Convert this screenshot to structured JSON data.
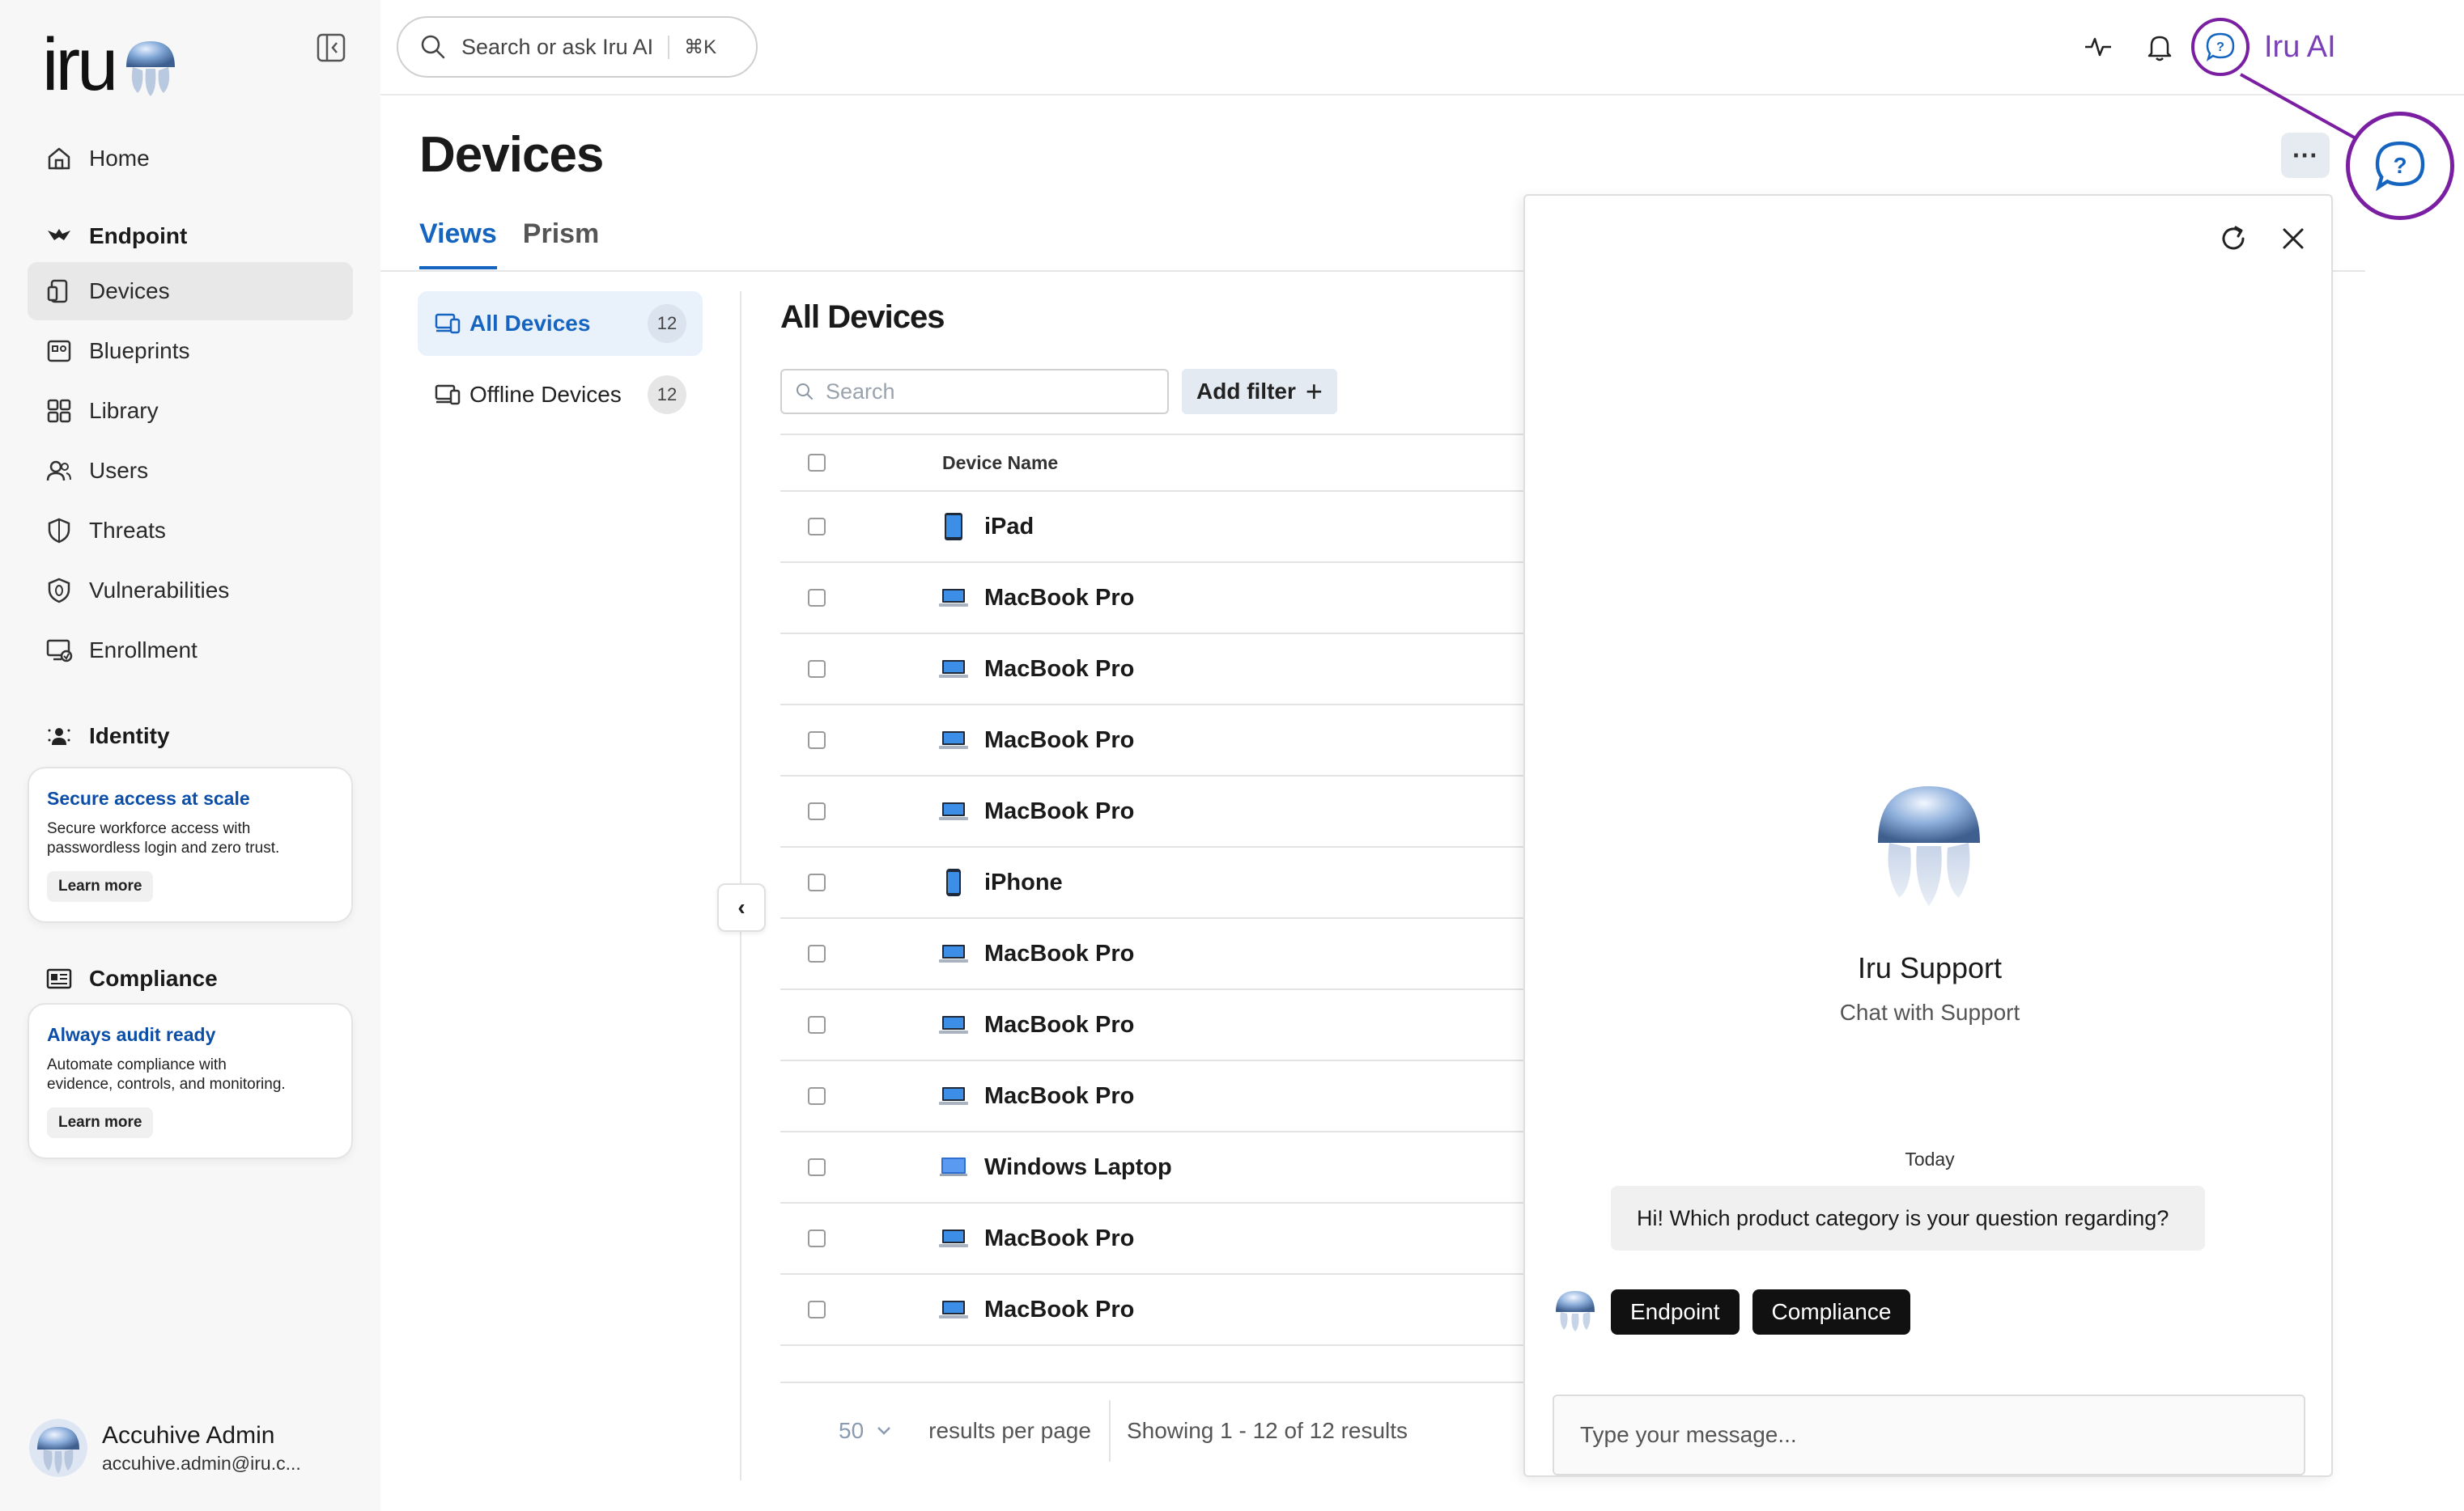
{
  "app": {
    "logo_text": "iru"
  },
  "sidebar": {
    "items": [
      {
        "label": "Home",
        "icon": "home-icon"
      },
      {
        "label": "Devices",
        "icon": "device-icon",
        "active": true
      },
      {
        "label": "Blueprints",
        "icon": "blueprint-icon"
      },
      {
        "label": "Library",
        "icon": "library-grid-icon"
      },
      {
        "label": "Users",
        "icon": "users-icon"
      },
      {
        "label": "Threats",
        "icon": "shield-icon"
      },
      {
        "label": "Vulnerabilities",
        "icon": "shield-bug-icon"
      },
      {
        "label": "Enrollment",
        "icon": "enrollment-icon"
      }
    ],
    "sections": {
      "endpoint": "Endpoint",
      "identity": "Identity",
      "compliance": "Compliance"
    },
    "promos": {
      "identity": {
        "title": "Secure access at scale",
        "body_line1": "Secure workforce access with",
        "body_line2": "passwordless login and zero trust.",
        "button": "Learn more"
      },
      "compliance": {
        "title": "Always audit ready",
        "body_line1": "Automate compliance with",
        "body_line2": "evidence, controls, and monitoring.",
        "button": "Learn more"
      }
    },
    "user": {
      "name": "Accuhive Admin",
      "email": "accuhive.admin@iru.c..."
    }
  },
  "topbar": {
    "search_placeholder": "Search or ask Iru AI",
    "search_shortcut": "⌘K",
    "iru_ai_label": "Iru AI",
    "accent_color": "#7b1fa2"
  },
  "page": {
    "title": "Devices",
    "more_label": "···",
    "tabs": [
      {
        "label": "Views",
        "active": true
      },
      {
        "label": "Prism",
        "active": false
      }
    ],
    "views": [
      {
        "label": "All Devices",
        "count": "12",
        "active": true
      },
      {
        "label": "Offline Devices",
        "count": "12",
        "active": false
      }
    ],
    "collapse_glyph": "‹"
  },
  "table": {
    "title": "All Devices",
    "search_placeholder": "Search",
    "add_filter_label": "Add filter",
    "add_filter_icon": "+",
    "column_header": "Device Name",
    "rows": [
      {
        "name": "iPad",
        "type": "tablet"
      },
      {
        "name": "MacBook Pro",
        "type": "laptop"
      },
      {
        "name": "MacBook Pro",
        "type": "laptop"
      },
      {
        "name": "MacBook Pro",
        "type": "laptop"
      },
      {
        "name": "MacBook Pro",
        "type": "laptop"
      },
      {
        "name": "iPhone",
        "type": "phone"
      },
      {
        "name": "MacBook Pro",
        "type": "laptop"
      },
      {
        "name": "MacBook Pro",
        "type": "laptop"
      },
      {
        "name": "MacBook Pro",
        "type": "laptop"
      },
      {
        "name": "Windows Laptop",
        "type": "windows-laptop"
      },
      {
        "name": "MacBook Pro",
        "type": "laptop"
      },
      {
        "name": "MacBook Pro",
        "type": "laptop"
      }
    ],
    "pager": {
      "page_size": "50",
      "per_page_label": "results per page",
      "showing": "Showing 1 - 12 of 12 results"
    }
  },
  "support": {
    "title": "Iru Support",
    "subtitle": "Chat with Support",
    "date_label": "Today",
    "message": "Hi! Which product category is your question regarding?",
    "chips": [
      "Endpoint",
      "Compliance"
    ],
    "input_placeholder": "Type your message..."
  }
}
